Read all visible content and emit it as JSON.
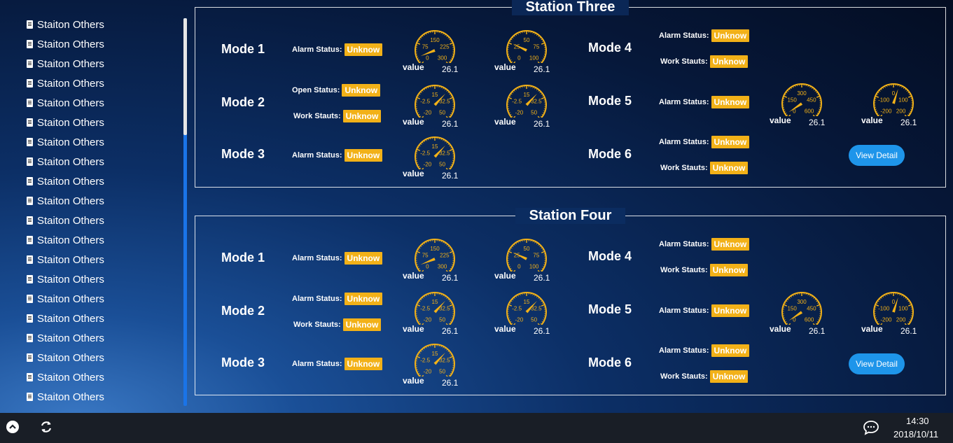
{
  "sidebar": {
    "items": [
      "Staiton Others",
      "Staiton Others",
      "Staiton Others",
      "Staiton Others",
      "Staiton Others",
      "Staiton Others",
      "Staiton Others",
      "Staiton Others",
      "Staiton Others",
      "Staiton Others",
      "Staiton Others",
      "Staiton Others",
      "Staiton Others",
      "Staiton Others",
      "Staiton Others",
      "Staiton Others",
      "Staiton Others",
      "Staiton Others",
      "Staiton Others",
      "Staiton Others"
    ]
  },
  "stations": [
    {
      "title": "Station Three",
      "modes": [
        "Mode 1",
        "Mode 2",
        "Mode 3",
        "Mode 4",
        "Mode 5",
        "Mode 6"
      ],
      "statuses": [
        {
          "label": "Alarm Status:",
          "value": "Unknow"
        },
        {
          "label": "Open Status:",
          "value": "Unknow"
        },
        {
          "label": "Work Stauts:",
          "value": "Unknow"
        },
        {
          "label": "Alarm Status:",
          "value": "Unknow"
        },
        {
          "label": "Alarm Status:",
          "value": "Unknow"
        },
        {
          "label": "Work Stauts:",
          "value": "Unknow"
        },
        {
          "label": "Alarm Status:",
          "value": "Unknow"
        },
        {
          "label": "Alarm Status:",
          "value": "Unknow"
        },
        {
          "label": "Work Stauts:",
          "value": "Unknow"
        }
      ],
      "gauges": [
        {
          "label": "value",
          "value": "26.1",
          "ticks": [
            "0",
            "75",
            "150",
            "225",
            "300"
          ]
        },
        {
          "label": "value",
          "value": "26.1",
          "ticks": [
            "0",
            "25",
            "50",
            "75",
            "100"
          ]
        },
        {
          "label": "value",
          "value": "26.1",
          "ticks": [
            "-20",
            "-2.5",
            "15",
            "32.5",
            "50"
          ]
        },
        {
          "label": "value",
          "value": "26.1",
          "ticks": [
            "-20",
            "-2.5",
            "15",
            "32.5",
            "50"
          ]
        },
        {
          "label": "value",
          "value": "26.1",
          "ticks": [
            "-20",
            "-2.5",
            "15",
            "32.5",
            "50"
          ]
        },
        {
          "label": "value",
          "value": "26.1",
          "ticks": [
            "0",
            "150",
            "300",
            "450",
            "600"
          ]
        },
        {
          "label": "value",
          "value": "26.1",
          "ticks": [
            "-200",
            "-100",
            "0",
            "100",
            "200"
          ]
        }
      ],
      "button": "View Detail"
    },
    {
      "title": "Station Four",
      "modes": [
        "Mode 1",
        "Mode 2",
        "Mode 3",
        "Mode 4",
        "Mode 5",
        "Mode 6"
      ],
      "statuses": [
        {
          "label": "Alarm Status:",
          "value": "Unknow"
        },
        {
          "label": "Alarm Status:",
          "value": "Unknow"
        },
        {
          "label": "Work Stauts:",
          "value": "Unknow"
        },
        {
          "label": "Alarm Status:",
          "value": "Unknow"
        },
        {
          "label": "Alarm Status:",
          "value": "Unknow"
        },
        {
          "label": "Work Stauts:",
          "value": "Unknow"
        },
        {
          "label": "Alarm Status:",
          "value": "Unknow"
        },
        {
          "label": "Alarm Status:",
          "value": "Unknow"
        },
        {
          "label": "Work Stauts:",
          "value": "Unknow"
        }
      ],
      "gauges": [
        {
          "label": "value",
          "value": "26.1",
          "ticks": [
            "0",
            "75",
            "150",
            "225",
            "300"
          ]
        },
        {
          "label": "value",
          "value": "26.1",
          "ticks": [
            "0",
            "25",
            "50",
            "75",
            "100"
          ]
        },
        {
          "label": "value",
          "value": "26.1",
          "ticks": [
            "-20",
            "-2.5",
            "15",
            "32.5",
            "50"
          ]
        },
        {
          "label": "value",
          "value": "26.1",
          "ticks": [
            "-20",
            "-2.5",
            "15",
            "32.5",
            "50"
          ]
        },
        {
          "label": "value",
          "value": "26.1",
          "ticks": [
            "-20",
            "-2.5",
            "15",
            "32.5",
            "50"
          ]
        },
        {
          "label": "value",
          "value": "26.1",
          "ticks": [
            "0",
            "150",
            "300",
            "450",
            "600"
          ]
        },
        {
          "label": "value",
          "value": "26.1",
          "ticks": [
            "-200",
            "-100",
            "0",
            "100",
            "200"
          ]
        }
      ],
      "button": "View Detail"
    }
  ],
  "taskbar": {
    "time": "14:30",
    "date": "2018/10/11",
    "icons": [
      "chevron-up-icon",
      "refresh-icon",
      "chat-icon"
    ]
  },
  "colors": {
    "badge": "#f2b118",
    "button": "#1e95ea",
    "gauge": "#f2b118",
    "scrollbar": "#1a74e8"
  }
}
